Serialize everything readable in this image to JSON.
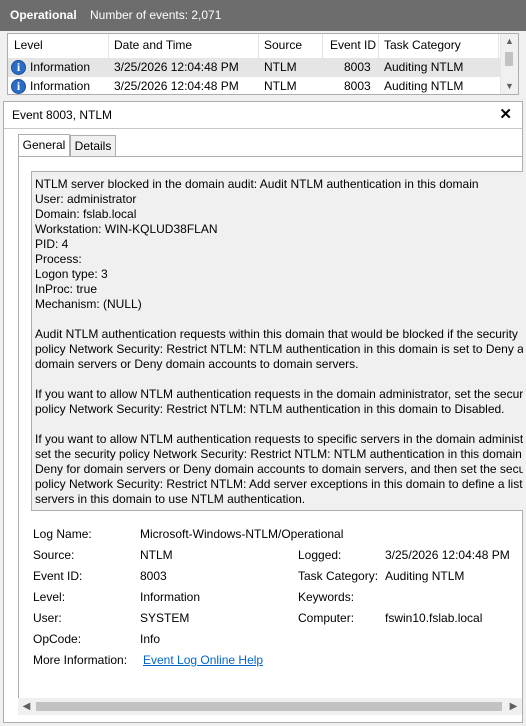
{
  "header": {
    "log_name": "Operational",
    "event_count": "Number of events: 2,071"
  },
  "grid": {
    "columns": [
      "Level",
      "Date and Time",
      "Source",
      "Event ID",
      "Task Category"
    ],
    "rows": [
      {
        "level": "Information",
        "date": "3/25/2026 12:04:48 PM",
        "source": "NTLM",
        "id": "8003",
        "category": "Auditing NTLM"
      },
      {
        "level": "Information",
        "date": "3/25/2026 12:04:48 PM",
        "source": "NTLM",
        "id": "8003",
        "category": "Auditing NTLM"
      }
    ],
    "icon": "info-icon"
  },
  "panel": {
    "title": "Event 8003, NTLM",
    "tabs": [
      "General",
      "Details"
    ],
    "description": [
      "NTLM server blocked in the domain audit: Audit NTLM authentication in this domain",
      "User: administrator",
      "Domain: fslab.local",
      "Workstation: WIN-KQLUD38FLAN",
      "PID: 4",
      "Process:",
      "Logon type: 3",
      "InProc: true",
      "Mechanism: (NULL)",
      "",
      "Audit NTLM authentication requests within this domain that would be blocked if the security",
      "policy Network Security: Restrict NTLM: NTLM authentication in this domain is set to Deny all,",
      "domain servers or Deny domain accounts to domain servers.",
      "",
      "If you want to allow NTLM authentication requests in the domain administrator, set the security",
      "policy Network Security: Restrict NTLM: NTLM authentication in this domain to Disabled.",
      "",
      "If you want to allow NTLM authentication requests to specific servers in the domain administrator,",
      "set the security policy Network Security: Restrict NTLM: NTLM authentication in this domain to",
      "Deny for domain servers or Deny domain accounts to domain servers, and then set the security",
      "policy Network Security: Restrict NTLM: Add server exceptions in this domain to define a list of",
      "servers in this domain to use NTLM authentication."
    ],
    "fields": {
      "log_name_label": "Log Name:",
      "log_name": "Microsoft-Windows-NTLM/Operational",
      "source_label": "Source:",
      "source": "NTLM",
      "logged_label": "Logged:",
      "logged": "3/25/2026 12:04:48 PM",
      "event_id_label": "Event ID:",
      "event_id": "8003",
      "task_label": "Task Category:",
      "task": "Auditing NTLM",
      "level_label": "Level:",
      "level": "Information",
      "keywords_label": "Keywords:",
      "keywords": "",
      "user_label": "User:",
      "user": "SYSTEM",
      "computer_label": "Computer:",
      "computer": "fswin10.fslab.local",
      "opcode_label": "OpCode:",
      "opcode": "Info",
      "more_label": "More Information:",
      "more_link": "Event Log Online Help"
    }
  }
}
